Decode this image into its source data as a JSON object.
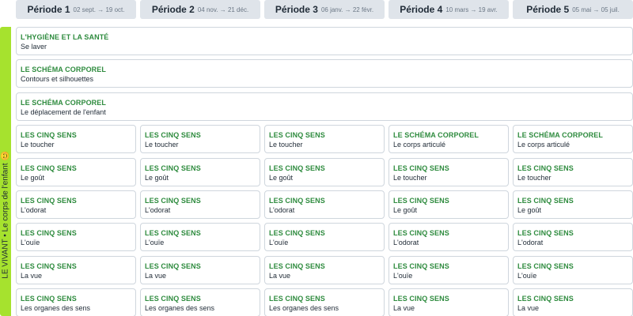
{
  "periods": [
    {
      "name": "Période 1",
      "dates": "02 sept. → 19 oct."
    },
    {
      "name": "Période 2",
      "dates": "04 nov. → 21 déc."
    },
    {
      "name": "Période 3",
      "dates": "06 janv. → 22 févr."
    },
    {
      "name": "Période 4",
      "dates": "10 mars → 19 avr."
    },
    {
      "name": "Période 5",
      "dates": "05 mai → 05 juil."
    }
  ],
  "domain_label": "LE VIVANT • Le corps de l'enfant 😊",
  "full_rows": [
    {
      "title": "L'HYGIÈNE ET LA SANTÉ",
      "sub": "Se laver"
    },
    {
      "title": "LE SCHÉMA CORPOREL",
      "sub": "Contours et silhouettes"
    },
    {
      "title": "LE SCHÉMA CORPOREL",
      "sub": "Le déplacement de l'enfant"
    }
  ],
  "grid_rows": [
    [
      {
        "title": "LES CINQ SENS",
        "sub": "Le toucher"
      },
      {
        "title": "LES CINQ SENS",
        "sub": "Le toucher"
      },
      {
        "title": "LES CINQ SENS",
        "sub": "Le toucher"
      },
      {
        "title": "LE SCHÉMA CORPOREL",
        "sub": "Le corps articulé"
      },
      {
        "title": "LE SCHÉMA CORPOREL",
        "sub": "Le corps articulé"
      }
    ],
    [
      {
        "title": "LES CINQ SENS",
        "sub": "Le goût"
      },
      {
        "title": "LES CINQ SENS",
        "sub": "Le goût"
      },
      {
        "title": "LES CINQ SENS",
        "sub": "Le goût"
      },
      {
        "title": "LES CINQ SENS",
        "sub": "Le toucher"
      },
      {
        "title": "LES CINQ SENS",
        "sub": "Le toucher"
      }
    ],
    [
      {
        "title": "LES CINQ SENS",
        "sub": "L'odorat"
      },
      {
        "title": "LES CINQ SENS",
        "sub": "L'odorat"
      },
      {
        "title": "LES CINQ SENS",
        "sub": "L'odorat"
      },
      {
        "title": "LES CINQ SENS",
        "sub": "Le goût"
      },
      {
        "title": "LES CINQ SENS",
        "sub": "Le goût"
      }
    ],
    [
      {
        "title": "LES CINQ SENS",
        "sub": "L'ouïe"
      },
      {
        "title": "LES CINQ SENS",
        "sub": "L'ouïe"
      },
      {
        "title": "LES CINQ SENS",
        "sub": "L'ouïe"
      },
      {
        "title": "LES CINQ SENS",
        "sub": "L'odorat"
      },
      {
        "title": "LES CINQ SENS",
        "sub": "L'odorat"
      }
    ],
    [
      {
        "title": "LES CINQ SENS",
        "sub": "La vue"
      },
      {
        "title": "LES CINQ SENS",
        "sub": "La vue"
      },
      {
        "title": "LES CINQ SENS",
        "sub": "La vue"
      },
      {
        "title": "LES CINQ SENS",
        "sub": "L'ouïe"
      },
      {
        "title": "LES CINQ SENS",
        "sub": "L'ouïe"
      }
    ],
    [
      {
        "title": "LES CINQ SENS",
        "sub": "Les organes des sens"
      },
      {
        "title": "LES CINQ SENS",
        "sub": "Les organes des sens"
      },
      {
        "title": "LES CINQ SENS",
        "sub": "Les organes des sens"
      },
      {
        "title": "LES CINQ SENS",
        "sub": "La vue"
      },
      {
        "title": "LES CINQ SENS",
        "sub": "La vue"
      }
    ]
  ],
  "colors": {
    "accent_green": "#2e8b3e",
    "side_bar": "#a6e22e",
    "header_bg": "#dfe4ea"
  }
}
